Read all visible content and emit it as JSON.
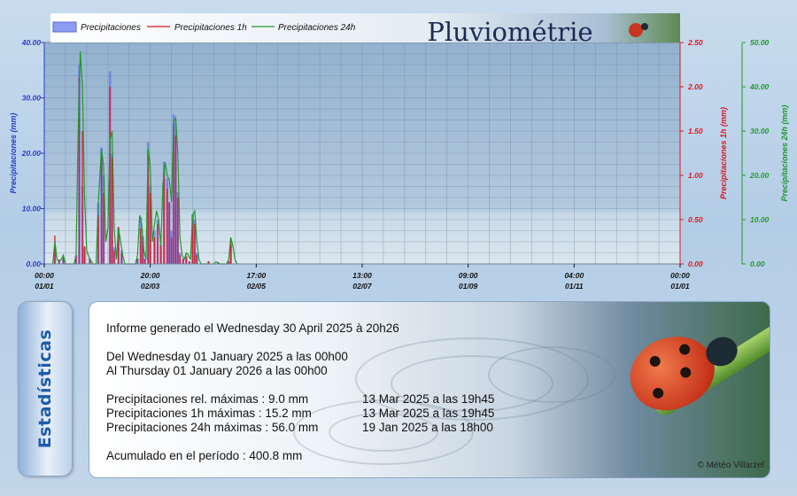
{
  "chart_data": {
    "type": "bar+line",
    "title": "Pluviométrie",
    "legend": {
      "placement": "top-left",
      "entries": [
        "Precipitaciones",
        "Precipitaciones 1h",
        "Precipitaciones 24h"
      ]
    },
    "x_ticks": [
      {
        "time": "00:00",
        "date": "01/01"
      },
      {
        "time": "20:00",
        "date": "02/03"
      },
      {
        "time": "17:00",
        "date": "02/05"
      },
      {
        "time": "13:00",
        "date": "02/07"
      },
      {
        "time": "09:00",
        "date": "01/09"
      },
      {
        "time": "04:00",
        "date": "01/11"
      },
      {
        "time": "00:00",
        "date": "01/01"
      }
    ],
    "axes": [
      {
        "label": "Precipitaciones (mm)",
        "color": "#2a3cc8",
        "side": "left",
        "range": [
          0,
          40
        ],
        "ticks": [
          "0.00",
          "10.00",
          "20.00",
          "30.00",
          "40.00"
        ]
      },
      {
        "label": "Precipitaciones 1h (mm)",
        "color": "#e0161e",
        "side": "right",
        "range": [
          0,
          2.5
        ],
        "ticks": [
          "0.00",
          "0.50",
          "1.00",
          "1.50",
          "2.00",
          "2.50"
        ]
      },
      {
        "label": "Precipitaciones 24h (mm)",
        "color": "#1e9a2a",
        "side": "right",
        "range": [
          0,
          50
        ],
        "ticks": [
          "0.00",
          "10.00",
          "20.00",
          "30.00",
          "40.00",
          "50.00"
        ]
      }
    ],
    "grid": true,
    "series": [
      {
        "name": "Precipitaciones",
        "color": "#6a7ce8",
        "style": "bar",
        "axis": 0,
        "points": [
          [
            0.1,
            3
          ],
          [
            0.14,
            0.5
          ],
          [
            0.18,
            1
          ],
          [
            0.3,
            1.5
          ],
          [
            0.33,
            36
          ],
          [
            0.36,
            14
          ],
          [
            0.38,
            3
          ],
          [
            0.43,
            1
          ],
          [
            0.51,
            11
          ],
          [
            0.54,
            21
          ],
          [
            0.56,
            16
          ],
          [
            0.62,
            34.8
          ],
          [
            0.64,
            20
          ],
          [
            0.66,
            3
          ],
          [
            0.7,
            6.5
          ],
          [
            0.73,
            2.5
          ],
          [
            0.88,
            1
          ],
          [
            0.91,
            8.5
          ],
          [
            0.93,
            5
          ],
          [
            0.95,
            1
          ],
          [
            0.98,
            22
          ],
          [
            1.0,
            14
          ],
          [
            1.04,
            6
          ],
          [
            1.07,
            8
          ],
          [
            1.1,
            3.5
          ],
          [
            1.13,
            18.5
          ],
          [
            1.16,
            15.5
          ],
          [
            1.18,
            11
          ],
          [
            1.2,
            6
          ],
          [
            1.22,
            27
          ],
          [
            1.24,
            25.5
          ],
          [
            1.26,
            13
          ],
          [
            1.28,
            2
          ],
          [
            1.31,
            1
          ],
          [
            1.34,
            1.5
          ],
          [
            1.37,
            0.5
          ],
          [
            1.4,
            9
          ],
          [
            1.42,
            8
          ],
          [
            1.44,
            2
          ],
          [
            1.55,
            0.5
          ],
          [
            1.64,
            0.3
          ],
          [
            1.74,
            0.5
          ],
          [
            1.76,
            3.5
          ]
        ]
      },
      {
        "name": "Precipitaciones 1h",
        "color": "#e0161e",
        "style": "bar",
        "axis": 1,
        "points": [
          [
            0.1,
            0.32
          ],
          [
            0.14,
            0.05
          ],
          [
            0.18,
            0.08
          ],
          [
            0.3,
            0.1
          ],
          [
            0.33,
            2.1
          ],
          [
            0.36,
            1.5
          ],
          [
            0.38,
            0.2
          ],
          [
            0.43,
            0.06
          ],
          [
            0.51,
            0.55
          ],
          [
            0.54,
            1.2
          ],
          [
            0.56,
            0.8
          ],
          [
            0.62,
            2.0
          ],
          [
            0.64,
            1.2
          ],
          [
            0.66,
            0.15
          ],
          [
            0.7,
            0.42
          ],
          [
            0.73,
            0.12
          ],
          [
            0.88,
            0.06
          ],
          [
            0.91,
            0.4
          ],
          [
            0.93,
            0.3
          ],
          [
            0.95,
            0.05
          ],
          [
            0.98,
            1.25
          ],
          [
            1.0,
            0.8
          ],
          [
            1.04,
            0.3
          ],
          [
            1.07,
            0.45
          ],
          [
            1.1,
            0.2
          ],
          [
            1.13,
            1.05
          ],
          [
            1.16,
            0.85
          ],
          [
            1.18,
            0.7
          ],
          [
            1.2,
            0.3
          ],
          [
            1.22,
            1.55
          ],
          [
            1.24,
            1.45
          ],
          [
            1.26,
            0.75
          ],
          [
            1.28,
            0.1
          ],
          [
            1.31,
            0.05
          ],
          [
            1.34,
            0.08
          ],
          [
            1.37,
            0.03
          ],
          [
            1.4,
            0.55
          ],
          [
            1.42,
            0.45
          ],
          [
            1.44,
            0.1
          ],
          [
            1.55,
            0.03
          ],
          [
            1.64,
            0.02
          ],
          [
            1.74,
            0.03
          ],
          [
            1.76,
            0.28
          ]
        ]
      },
      {
        "name": "Precipitaciones 24h",
        "color": "#1e9a2a",
        "style": "line",
        "axis": 2,
        "points": [
          [
            0.08,
            0
          ],
          [
            0.1,
            5
          ],
          [
            0.12,
            1
          ],
          [
            0.14,
            0.5
          ],
          [
            0.16,
            1
          ],
          [
            0.18,
            2
          ],
          [
            0.2,
            0
          ],
          [
            0.28,
            0
          ],
          [
            0.3,
            2
          ],
          [
            0.32,
            30
          ],
          [
            0.34,
            48
          ],
          [
            0.36,
            40
          ],
          [
            0.38,
            15
          ],
          [
            0.4,
            3
          ],
          [
            0.43,
            1
          ],
          [
            0.46,
            0
          ],
          [
            0.49,
            0
          ],
          [
            0.51,
            14
          ],
          [
            0.54,
            26
          ],
          [
            0.56,
            22
          ],
          [
            0.58,
            5
          ],
          [
            0.6,
            8
          ],
          [
            0.62,
            28
          ],
          [
            0.64,
            30
          ],
          [
            0.66,
            8
          ],
          [
            0.68,
            1
          ],
          [
            0.7,
            8
          ],
          [
            0.72,
            5
          ],
          [
            0.74,
            2
          ],
          [
            0.76,
            0
          ],
          [
            0.86,
            0
          ],
          [
            0.88,
            2
          ],
          [
            0.9,
            11
          ],
          [
            0.92,
            9
          ],
          [
            0.94,
            3
          ],
          [
            0.96,
            1
          ],
          [
            0.98,
            26
          ],
          [
            1.0,
            22
          ],
          [
            1.02,
            5
          ],
          [
            1.04,
            9
          ],
          [
            1.06,
            12
          ],
          [
            1.08,
            10
          ],
          [
            1.1,
            4
          ],
          [
            1.12,
            18
          ],
          [
            1.14,
            23
          ],
          [
            1.16,
            20
          ],
          [
            1.18,
            19
          ],
          [
            1.2,
            14
          ],
          [
            1.22,
            32
          ],
          [
            1.24,
            33
          ],
          [
            1.26,
            25
          ],
          [
            1.28,
            6
          ],
          [
            1.3,
            2
          ],
          [
            1.32,
            1
          ],
          [
            1.34,
            2.5
          ],
          [
            1.36,
            2
          ],
          [
            1.38,
            1
          ],
          [
            1.4,
            11
          ],
          [
            1.42,
            12
          ],
          [
            1.44,
            5
          ],
          [
            1.46,
            1
          ],
          [
            1.48,
            0
          ],
          [
            1.6,
            0
          ],
          [
            1.62,
            0.5
          ],
          [
            1.66,
            0
          ],
          [
            1.72,
            0
          ],
          [
            1.74,
            1
          ],
          [
            1.76,
            6
          ],
          [
            1.78,
            4
          ],
          [
            1.8,
            1
          ],
          [
            1.82,
            0
          ]
        ]
      }
    ]
  },
  "stats": {
    "tab_label": "Estadísticas",
    "report_line": "Informe generado el Wednesday 30 April 2025 à 20h26",
    "from_line": "Del Wednesday 01 January 2025 a las 00h00",
    "to_line": "Al Thursday 01 January 2026 a las 00h00",
    "rows": [
      {
        "label": "Precipitaciones rel. máximas : 9.0 mm",
        "when": "13 Mar 2025 a las 19h45"
      },
      {
        "label": "Precipitaciones 1h máximas : 15.2 mm",
        "when": "13 Mar 2025 a las 19h45"
      },
      {
        "label": "Precipitaciones 24h máximas : 56.0 mm",
        "when": "19 Jan 2025 a las 18h00"
      }
    ],
    "accum_line": "Acumulado en el período : 400.8 mm",
    "copyright": "© Météo Villarzel"
  }
}
